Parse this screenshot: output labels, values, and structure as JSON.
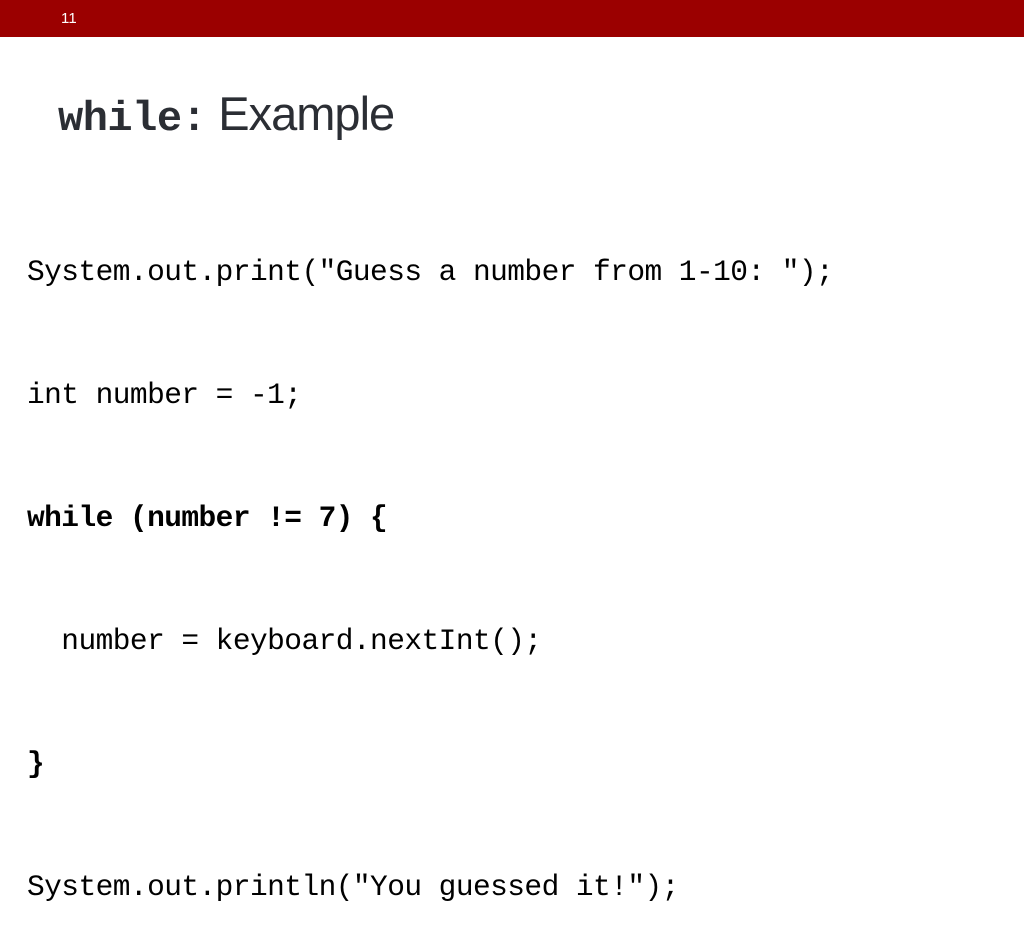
{
  "slide": {
    "number": "11",
    "header_color": "#9B0000",
    "title": {
      "mono_part": "while:",
      "sans_part": " Example",
      "color": "#2B2E34"
    },
    "code": {
      "language": "java",
      "text_color": "#000000",
      "lines": [
        {
          "text": "System.out.print(\"Guess a number from 1-10: \");",
          "bold": false
        },
        {
          "text": "int number = -1;",
          "bold": false
        },
        {
          "text": "while (number != 7) {",
          "bold": true
        },
        {
          "text": "  number = keyboard.nextInt();",
          "bold": false
        },
        {
          "text": "}",
          "bold": true
        },
        {
          "text": "System.out.println(\"You guessed it!\");",
          "bold": false
        }
      ]
    }
  }
}
